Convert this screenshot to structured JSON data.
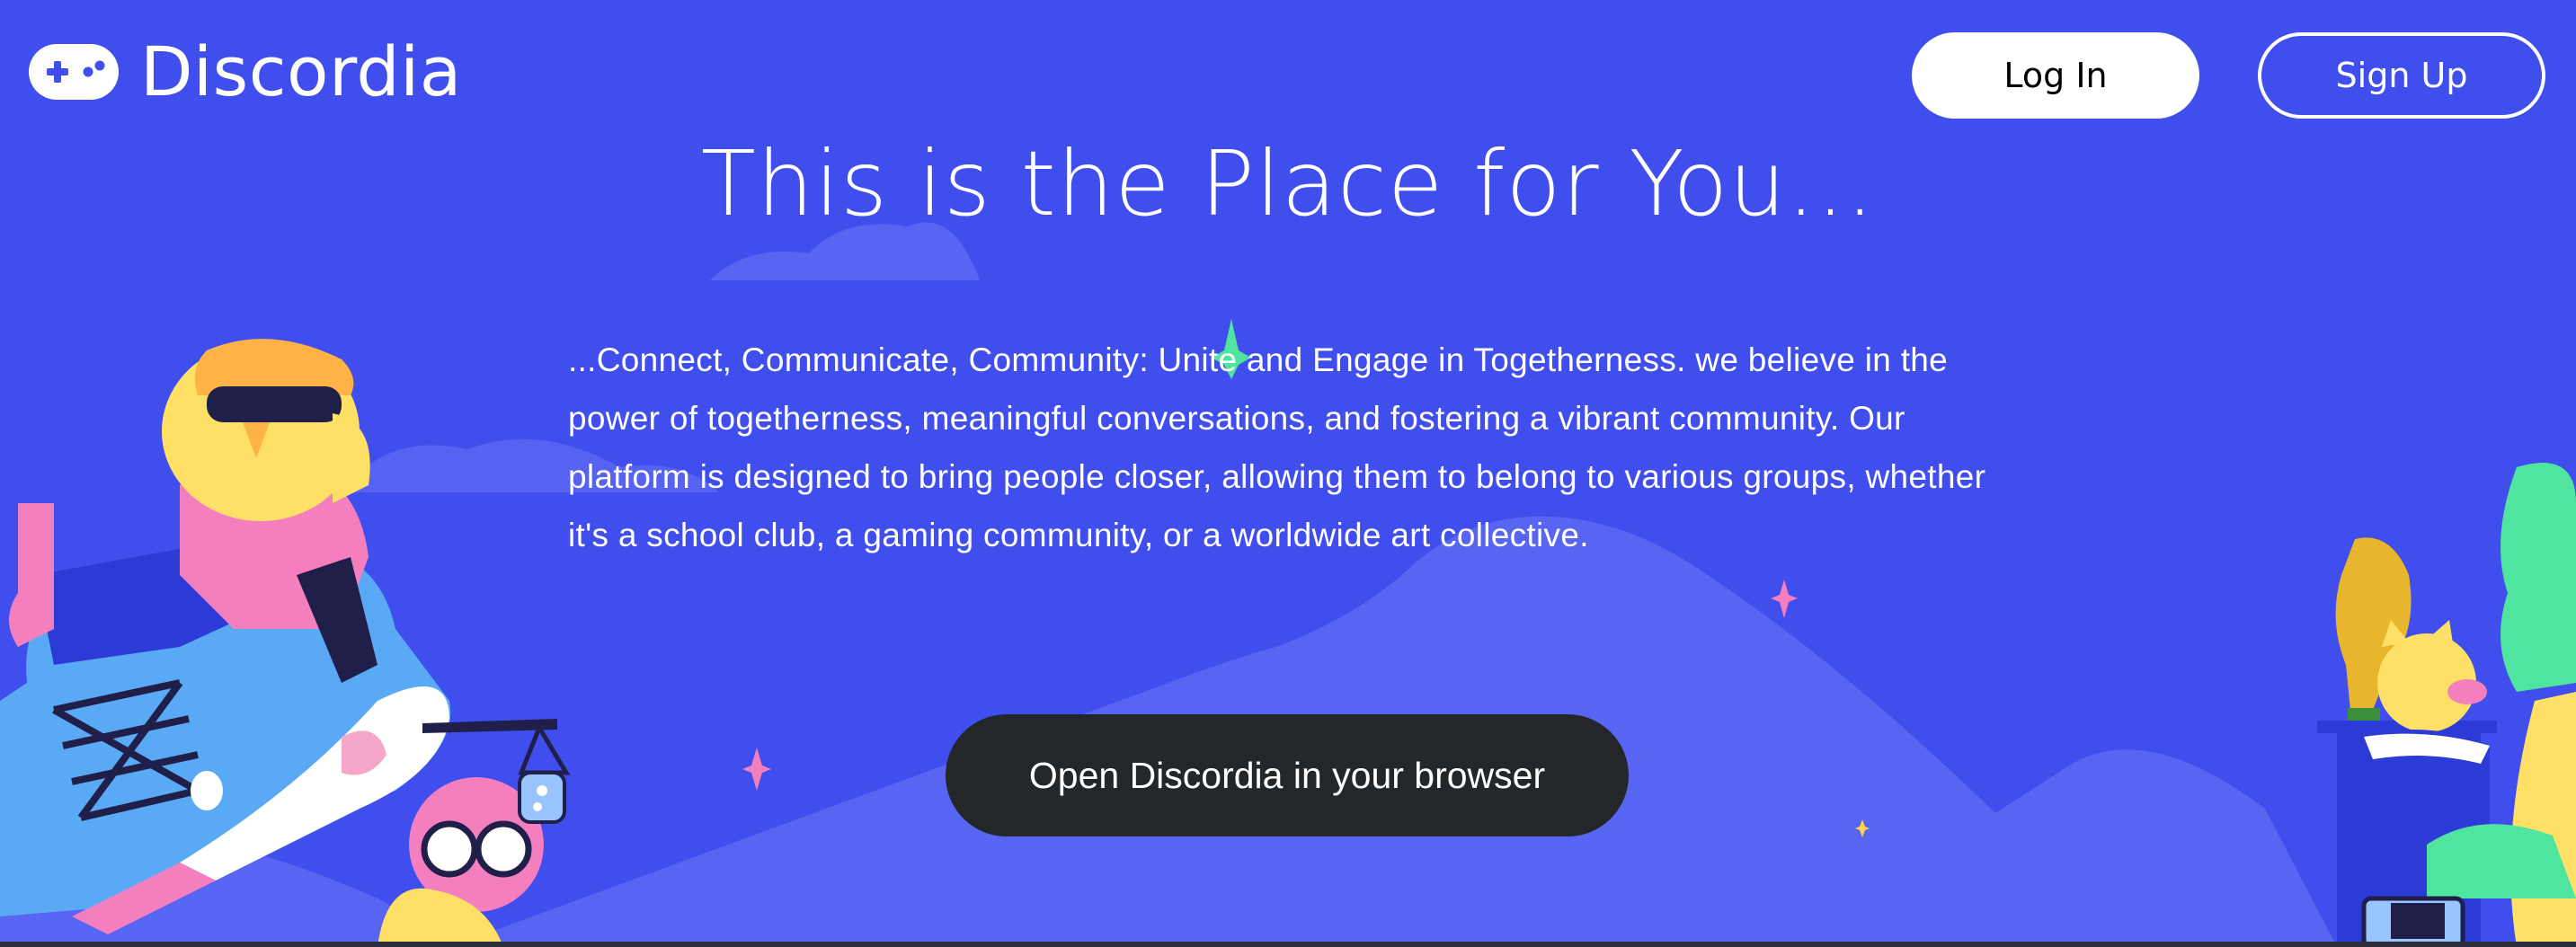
{
  "header": {
    "logo_text": "Discordia",
    "login_label": "Log In",
    "signup_label": "Sign Up"
  },
  "hero": {
    "title": "This is the Place for You...",
    "description": "...Connect, Communicate, Community: Unite and Engage in Togetherness. we believe in the power of togetherness, meaningful conversations, and fostering a vibrant community. Our platform is designed to bring people closer, allowing them to belong to various groups, whether it's a school club, a gaming community, or a worldwide art collective.",
    "cta_label": "Open Discordia in your browser"
  },
  "colors": {
    "background": "#404EED",
    "cta_background": "#23272A",
    "hill": "#5865F2",
    "text": "#FFFFFF"
  },
  "icons": {
    "logo": "gamepad-icon",
    "decorations": [
      "sparkle-icon",
      "cloud-icon",
      "hill-icon"
    ]
  }
}
